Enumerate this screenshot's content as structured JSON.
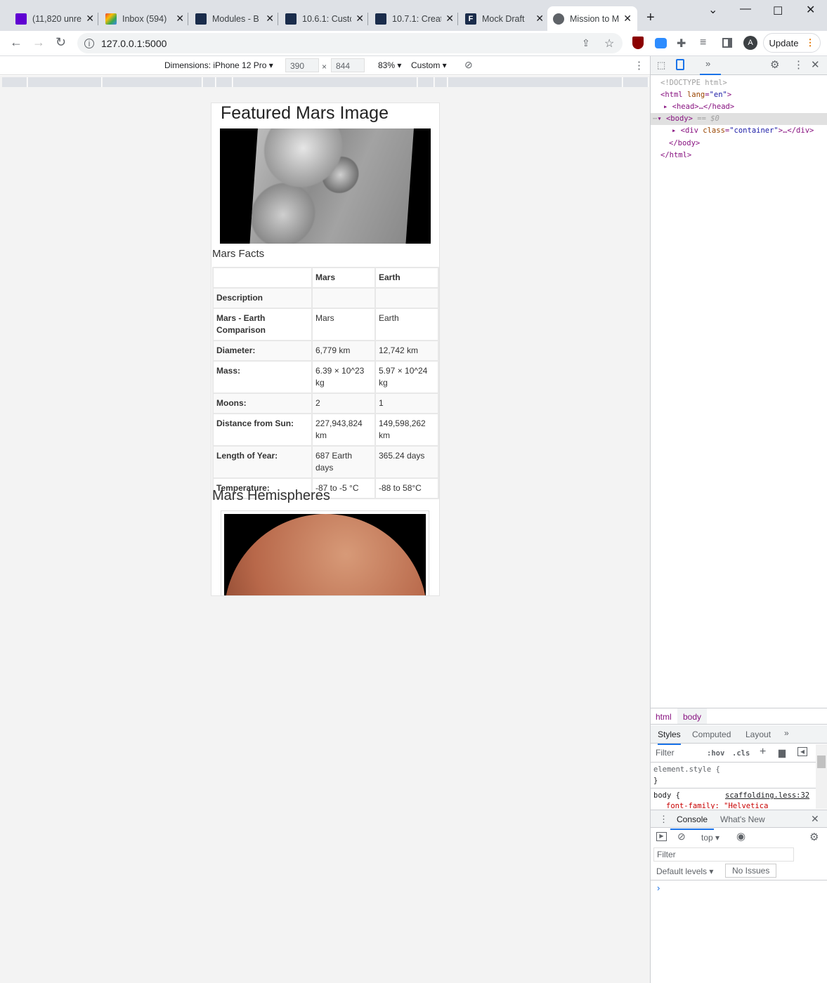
{
  "browser": {
    "tabs": [
      {
        "title": "(11,820 unre",
        "icon": "yahoo-mail-icon",
        "color": "#6001d2"
      },
      {
        "title": "Inbox (594)",
        "icon": "gmail-icon",
        "color": "#ea4335"
      },
      {
        "title": "Modules - B",
        "icon": "bootcamp-icon",
        "color": "#1a2c4b"
      },
      {
        "title": "10.6.1: Custo",
        "icon": "bootcamp-icon",
        "color": "#1a2c4b"
      },
      {
        "title": "10.7.1: Creat",
        "icon": "bootcamp-icon",
        "color": "#1a2c4b"
      },
      {
        "title": "Mock Draft",
        "icon": "fantasy-icon",
        "color": "#1a2c4b"
      },
      {
        "title": "Mission to M",
        "icon": "globe-icon",
        "color": "#5f6368"
      }
    ],
    "url": "127.0.0.1:5000",
    "update_label": "Update",
    "profile_initial": "A"
  },
  "device_toolbar": {
    "dimensions_label": "Dimensions: iPhone 12 Pro",
    "width": "390",
    "height": "844",
    "times": "×",
    "zoom": "83%",
    "throttle": "Custom"
  },
  "page": {
    "featured_title": "Featured Mars Image",
    "facts_title": "Mars Facts",
    "table": {
      "headers": [
        "",
        "Mars",
        "Earth"
      ],
      "rows": [
        [
          "Description",
          "",
          ""
        ],
        [
          "Mars - Earth Comparison",
          "Mars",
          "Earth"
        ],
        [
          "Diameter:",
          "6,779 km",
          "12,742 km"
        ],
        [
          "Mass:",
          "6.39 × 10^23 kg",
          "5.97 × 10^24 kg"
        ],
        [
          "Moons:",
          "2",
          "1"
        ],
        [
          "Distance from Sun:",
          "227,943,824 km",
          "149,598,262 km"
        ],
        [
          "Length of Year:",
          "687 Earth days",
          "365.24 days"
        ],
        [
          "Temperature:",
          "-87 to -5 °C",
          "-88 to 58°C"
        ]
      ]
    },
    "hemispheres_title": "Mars Hemispheres"
  },
  "devtools": {
    "elements": {
      "doctype": "<!DOCTYPE html>",
      "html_open": "<html",
      "lang_attr": "lang",
      "lang_val": "\"en\"",
      "head": "<head>…</head>",
      "body_open": "<body>",
      "body_sel": "== $0",
      "div_open": "<div",
      "class_attr": "class",
      "class_val": "\"container\"",
      "div_rest": ">…</div>",
      "body_close": "</body>",
      "html_close": "</html>"
    },
    "breadcrumbs": [
      "html",
      "body"
    ],
    "style_tabs": [
      "Styles",
      "Computed",
      "Layout"
    ],
    "filter_placeholder": "Filter",
    "hov": ":hov",
    "cls": ".cls",
    "element_style": "element.style {",
    "close_brace": "}",
    "body_rule": "body {",
    "body_source": "scaffolding.less:32",
    "font_family_line": "font-family: \"Helvetica",
    "drawer_tabs": [
      "Console",
      "What's New"
    ],
    "context": "top",
    "console_filter": "Filter",
    "levels": "Default levels",
    "issues": "No Issues"
  }
}
